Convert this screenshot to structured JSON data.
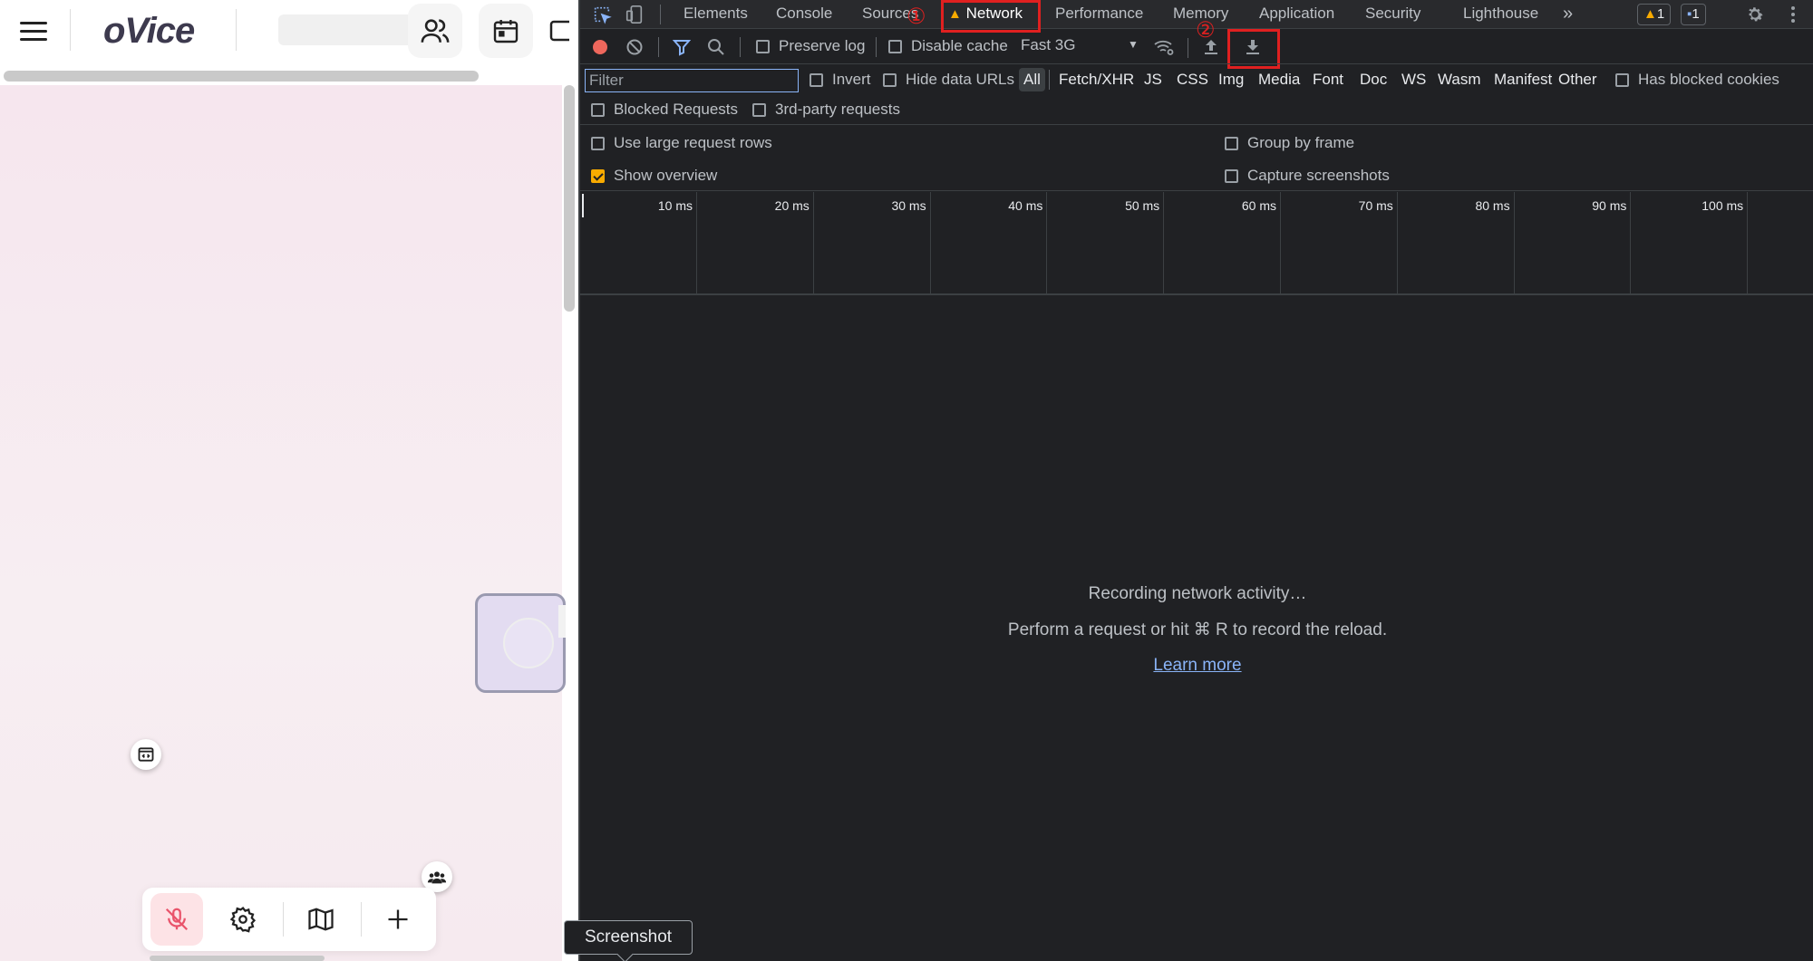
{
  "app": {
    "logo": "oVice",
    "header_buttons": [
      "members-icon",
      "calendar-icon"
    ],
    "bottom_bar": [
      "mic-off-icon",
      "gear-icon",
      "map-icon",
      "plus-icon"
    ]
  },
  "devtools": {
    "tabs": [
      {
        "label": "Elements"
      },
      {
        "label": "Console"
      },
      {
        "label": "Sources"
      },
      {
        "label": "Network",
        "active": true,
        "warning": true
      },
      {
        "label": "Performance"
      },
      {
        "label": "Memory"
      },
      {
        "label": "Application"
      },
      {
        "label": "Security"
      },
      {
        "label": "Lighthouse"
      }
    ],
    "more_tabs": "»",
    "badges": {
      "warnings": "1",
      "messages": "1"
    },
    "annotations": {
      "one": "①",
      "two": "②"
    },
    "toolbar": {
      "preserve_log": "Preserve log",
      "disable_cache": "Disable cache",
      "throttling": "Fast 3G"
    },
    "filter": {
      "placeholder": "Filter",
      "invert": "Invert",
      "hide_data_urls": "Hide data URLs",
      "types": [
        "All",
        "Fetch/XHR",
        "JS",
        "CSS",
        "Img",
        "Media",
        "Font",
        "Doc",
        "WS",
        "Wasm",
        "Manifest",
        "Other"
      ],
      "has_blocked_cookies": "Has blocked cookies",
      "blocked_requests": "Blocked Requests",
      "third_party": "3rd-party requests"
    },
    "settings": {
      "large_rows": "Use large request rows",
      "group_by_frame": "Group by frame",
      "show_overview": "Show overview",
      "capture_screenshots": "Capture screenshots"
    },
    "overview_ticks": [
      "10 ms",
      "20 ms",
      "30 ms",
      "40 ms",
      "50 ms",
      "60 ms",
      "70 ms",
      "80 ms",
      "90 ms",
      "100 ms"
    ],
    "empty_state": {
      "line1": "Recording network activity…",
      "line2": "Perform a request or hit ⌘ R to record the reload.",
      "link": "Learn more"
    },
    "tooltip": "Screenshot",
    "colors": {
      "accent_warning": "#f9ab00",
      "annotation_red": "#e02020",
      "link": "#8ab4f8"
    }
  }
}
